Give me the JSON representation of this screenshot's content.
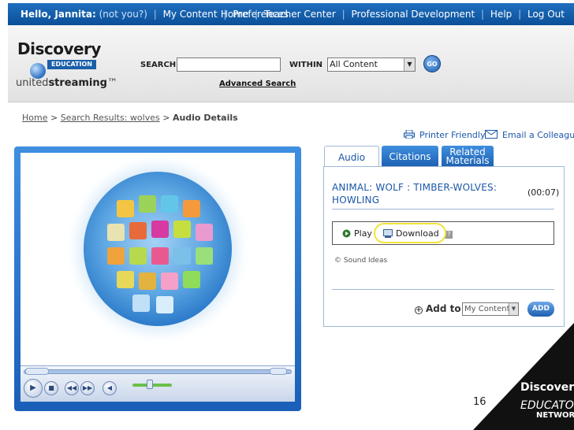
{
  "topnav": {
    "greeting": "Hello, Jannita:",
    "not_you": "(not you?)",
    "left_links": [
      "My Content",
      "Preferences"
    ],
    "right_links": [
      "Home",
      "Teacher Center",
      "Professional Development",
      "Help",
      "Log Out"
    ]
  },
  "logo": {
    "brand": "Discovery",
    "brand_sub": "EDUCATION",
    "product_prefix": "united",
    "product_bold": "streaming",
    "trademark": "™"
  },
  "search": {
    "label": "SEARCH",
    "value": "",
    "within_label": "WITHIN",
    "within_value": "All Content",
    "go_label": "GO",
    "advanced_label": "Advanced Search"
  },
  "breadcrumb": {
    "home": "Home",
    "sep": " > ",
    "results": "Search Results: wolves",
    "current": "Audio Details"
  },
  "utility": {
    "printer": "Printer Friendly",
    "email": "Email a Colleague"
  },
  "tabs": {
    "audio": "Audio",
    "citations": "Citations",
    "related_1": "Related",
    "related_2": "Materials"
  },
  "audio": {
    "title": "ANIMAL: WOLF : TIMBER-WOLVES: HOWLING",
    "duration": "(00:07)",
    "play_label": "Play",
    "download_label": "Download",
    "help_mark": "?",
    "credit": "© Sound Ideas"
  },
  "addto": {
    "label": "Add to",
    "value": "My Content",
    "button": "ADD"
  },
  "slide": {
    "number": "16"
  },
  "corner_logo": {
    "line1": "Discovery",
    "line2": "EDUCATOR",
    "line3": "NETWORK"
  },
  "colors": {
    "brand_blue": "#1b5fb0",
    "link_blue": "#1b57a8",
    "highlight": "#f2e33c"
  }
}
